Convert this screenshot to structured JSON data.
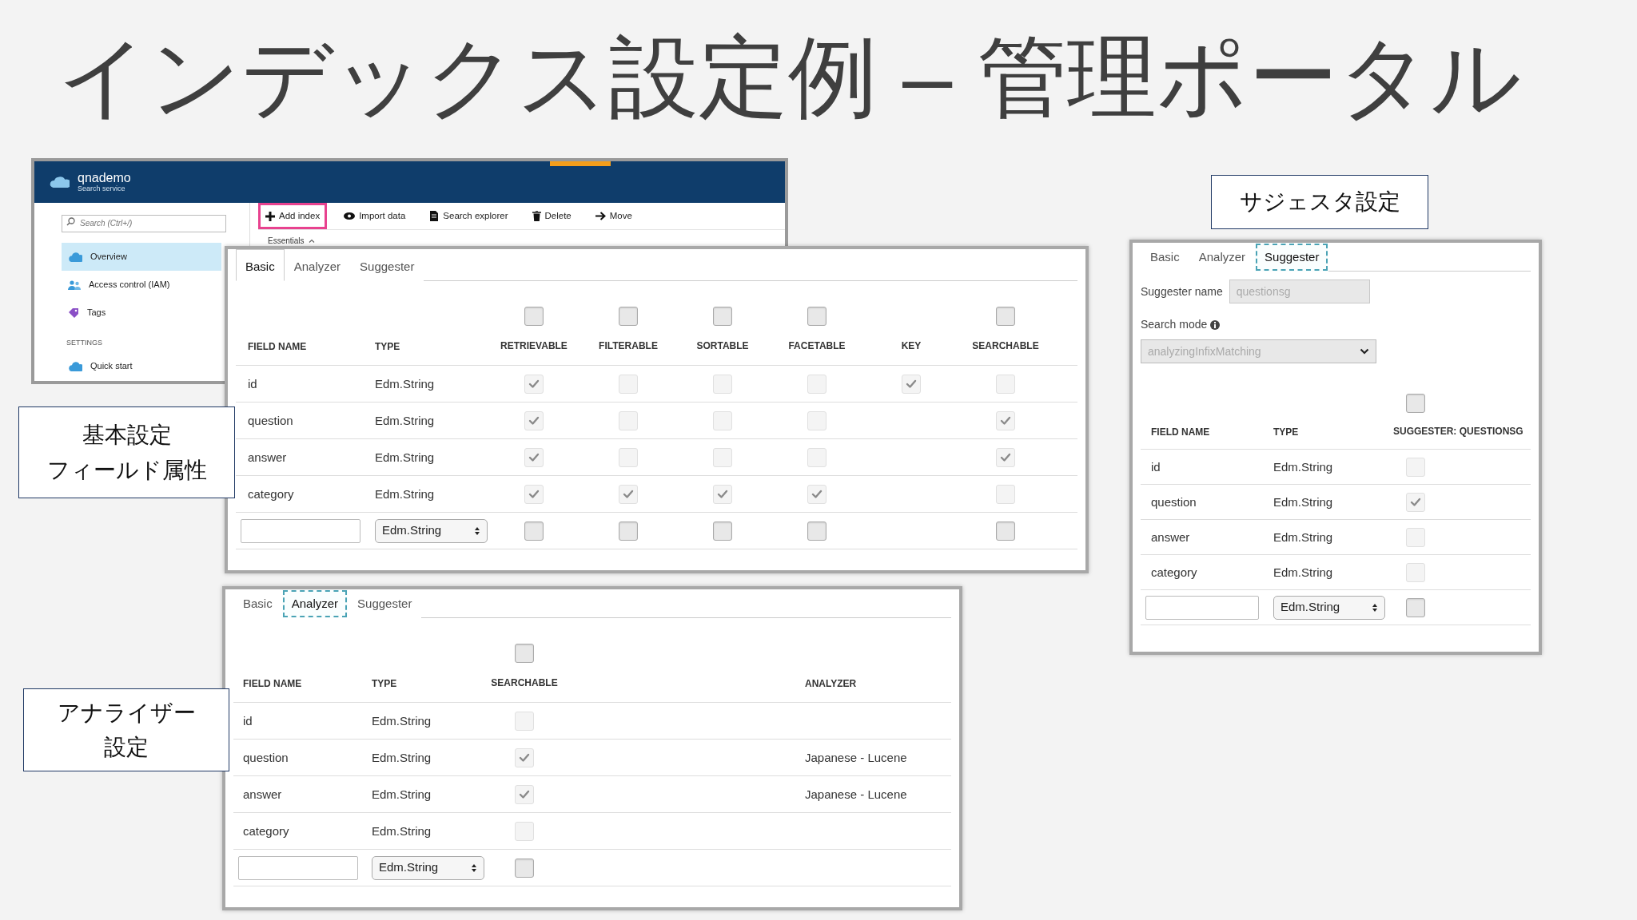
{
  "slide_title": "インデックス設定例 – 管理ポータル",
  "portal": {
    "resource_name": "qnademo",
    "resource_type": "Search service",
    "search": {
      "placeholder": "Search (Ctrl+/)"
    },
    "nav_items": [
      {
        "label": "Overview",
        "selected": true
      },
      {
        "label": "Access control (IAM)",
        "selected": false
      },
      {
        "label": "Tags",
        "selected": false
      }
    ],
    "settings_header": "SETTINGS",
    "settings_items": [
      {
        "label": "Quick start",
        "selected": false
      }
    ],
    "toolbar": [
      {
        "label": "Add index",
        "highlighted": true
      },
      {
        "label": "Import data",
        "highlighted": false
      },
      {
        "label": "Search explorer",
        "highlighted": false
      },
      {
        "label": "Delete",
        "highlighted": false
      },
      {
        "label": "Move",
        "highlighted": false
      }
    ],
    "essentials": "Essentials"
  },
  "basic_panel": {
    "tabs": [
      {
        "label": "Basic",
        "selected": true,
        "focused": false
      },
      {
        "label": "Analyzer",
        "selected": false,
        "focused": false
      },
      {
        "label": "Suggester",
        "selected": false,
        "focused": false
      }
    ],
    "columns": [
      {
        "label": "FIELD NAME",
        "kind": "name"
      },
      {
        "label": "TYPE",
        "kind": "type"
      },
      {
        "label": "RETRIEVABLE",
        "kind": "check",
        "select_all": {
          "checked": false
        }
      },
      {
        "label": "FILTERABLE",
        "kind": "check",
        "select_all": {
          "checked": false
        }
      },
      {
        "label": "SORTABLE",
        "kind": "check",
        "select_all": {
          "checked": false
        }
      },
      {
        "label": "FACETABLE",
        "kind": "check",
        "select_all": {
          "checked": false
        }
      },
      {
        "label": "KEY",
        "kind": "check"
      },
      {
        "label": "SEARCHABLE",
        "kind": "check",
        "select_all": {
          "checked": false
        }
      }
    ],
    "rows": [
      {
        "kind": "field",
        "field_name": "id",
        "type": "Edm.String",
        "cells": [
          {
            "checked": true
          },
          {
            "checked": false
          },
          {
            "checked": false
          },
          {
            "checked": false
          },
          {
            "checked": true
          },
          {
            "checked": false
          }
        ]
      },
      {
        "kind": "field",
        "field_name": "question",
        "type": "Edm.String",
        "cells": [
          {
            "checked": true
          },
          {
            "checked": false
          },
          {
            "checked": false
          },
          {
            "checked": false
          },
          null,
          {
            "checked": true
          }
        ]
      },
      {
        "kind": "field",
        "field_name": "answer",
        "type": "Edm.String",
        "cells": [
          {
            "checked": true
          },
          {
            "checked": false
          },
          {
            "checked": false
          },
          {
            "checked": false
          },
          null,
          {
            "checked": true
          }
        ]
      },
      {
        "kind": "field",
        "field_name": "category",
        "type": "Edm.String",
        "cells": [
          {
            "checked": true
          },
          {
            "checked": true
          },
          {
            "checked": true
          },
          {
            "checked": true
          },
          null,
          {
            "checked": false
          }
        ]
      },
      {
        "kind": "new",
        "type": "Edm.String",
        "cells": [
          {
            "checked": false
          },
          {
            "checked": false
          },
          {
            "checked": false
          },
          {
            "checked": false
          },
          null,
          {
            "checked": false
          }
        ]
      }
    ]
  },
  "basic_callout": [
    "基本設定",
    "フィールド属性"
  ],
  "suggester_callout": [
    "サジェスタ設定"
  ],
  "suggester_panel": {
    "tabs": [
      {
        "label": "Basic",
        "selected": false,
        "focused": false
      },
      {
        "label": "Analyzer",
        "selected": false,
        "focused": false
      },
      {
        "label": "Suggester",
        "selected": true,
        "focused": true
      }
    ],
    "name_label": "Suggester name",
    "name_value": "questionsg",
    "mode_label": "Search mode",
    "mode_value": "analyzingInfixMatching",
    "columns": [
      {
        "label": "FIELD NAME",
        "kind": "name"
      },
      {
        "label": "TYPE",
        "kind": "type"
      },
      {
        "label": "SUGGESTER: QUESTIONSG",
        "kind": "check",
        "select_all": {
          "checked": false
        }
      }
    ],
    "rows": [
      {
        "kind": "field",
        "field_name": "id",
        "type": "Edm.String",
        "cells": [
          {
            "checked": false
          }
        ]
      },
      {
        "kind": "field",
        "field_name": "question",
        "type": "Edm.String",
        "cells": [
          {
            "checked": true
          }
        ]
      },
      {
        "kind": "field",
        "field_name": "answer",
        "type": "Edm.String",
        "cells": [
          {
            "checked": false
          }
        ]
      },
      {
        "kind": "field",
        "field_name": "category",
        "type": "Edm.String",
        "cells": [
          {
            "checked": false
          }
        ]
      },
      {
        "kind": "new",
        "type": "Edm.String",
        "cells": [
          {
            "checked": false
          }
        ]
      }
    ]
  },
  "analyzer_panel": {
    "tabs": [
      {
        "label": "Basic",
        "selected": false,
        "focused": false
      },
      {
        "label": "Analyzer",
        "selected": true,
        "focused": true
      },
      {
        "label": "Suggester",
        "selected": false,
        "focused": false
      }
    ],
    "columns": [
      {
        "label": "FIELD NAME",
        "kind": "name"
      },
      {
        "label": "TYPE",
        "kind": "type"
      },
      {
        "label": "SEARCHABLE",
        "kind": "check",
        "select_all": {
          "checked": false
        }
      },
      {
        "label": "ANALYZER",
        "kind": "text"
      }
    ],
    "rows": [
      {
        "kind": "field",
        "field_name": "id",
        "type": "Edm.String",
        "cells": [
          {
            "checked": false
          },
          null
        ]
      },
      {
        "kind": "field",
        "field_name": "question",
        "type": "Edm.String",
        "cells": [
          {
            "checked": true
          },
          {
            "text": "Japanese - Lucene"
          }
        ]
      },
      {
        "kind": "field",
        "field_name": "answer",
        "type": "Edm.String",
        "cells": [
          {
            "checked": true
          },
          {
            "text": "Japanese - Lucene"
          }
        ]
      },
      {
        "kind": "field",
        "field_name": "category",
        "type": "Edm.String",
        "cells": [
          {
            "checked": false
          },
          null
        ]
      },
      {
        "kind": "new",
        "type": "Edm.String",
        "cells": [
          {
            "checked": false
          },
          null
        ]
      }
    ]
  },
  "analyzer_callout": [
    "アナライザー",
    "設定"
  ]
}
